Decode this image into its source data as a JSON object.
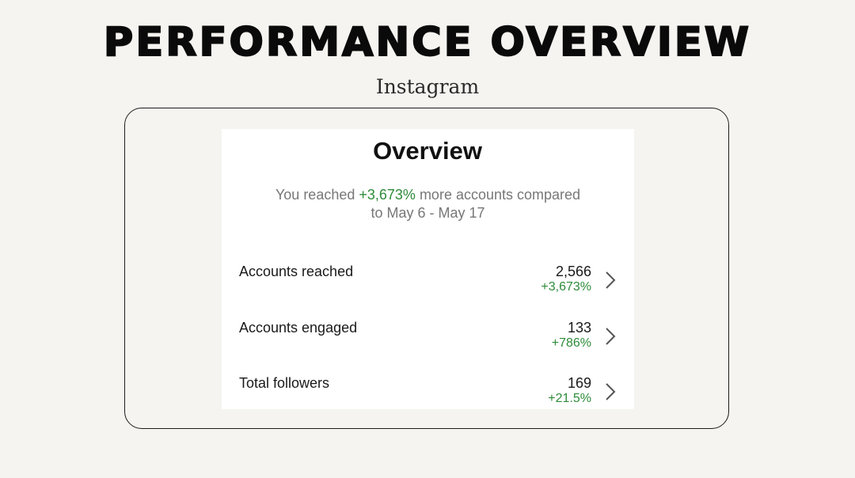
{
  "page": {
    "title": "PERFORMANCE OVERVIEW",
    "subtitle": "Instagram"
  },
  "overview": {
    "title": "Overview",
    "summary_prefix": "You reached ",
    "summary_highlight": "+3,673%",
    "summary_suffix": " more accounts compared",
    "summary_line2": "to May 6 - May 17",
    "rows": [
      {
        "label": "Accounts reached",
        "value": "2,566",
        "change": "+3,673%"
      },
      {
        "label": "Accounts engaged",
        "value": "133",
        "change": "+786%"
      },
      {
        "label": "Total followers",
        "value": "169",
        "change": "+21.5%"
      }
    ]
  },
  "icons": {
    "row_arrow": "chevron-right-icon"
  },
  "colors": {
    "background": "#f5f4f0",
    "positive": "#2e8b3a",
    "muted_text": "#777777",
    "card": "#ffffff"
  }
}
